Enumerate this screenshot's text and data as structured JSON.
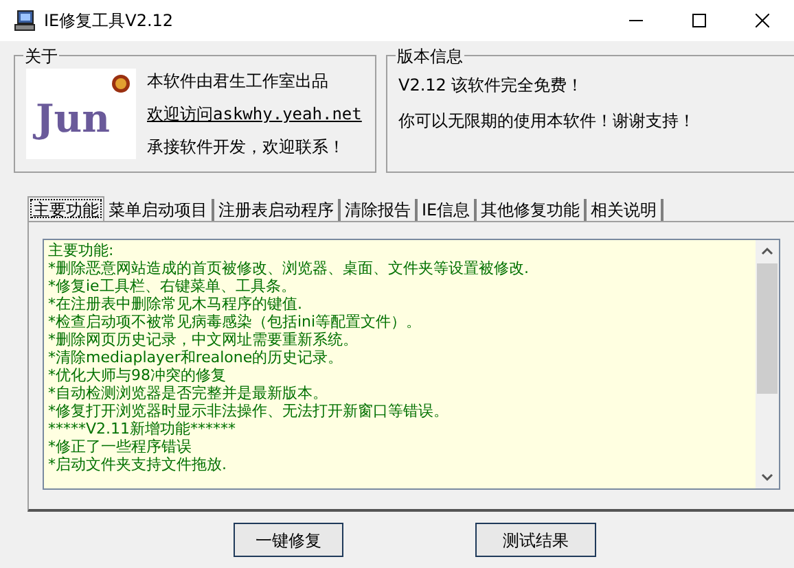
{
  "window": {
    "title": "IE修复工具V2.12"
  },
  "about": {
    "title": "关于",
    "logo_text": "Jun",
    "lines": [
      {
        "text": "本软件由君生工作室出品",
        "kind": "text"
      },
      {
        "text": "欢迎访问askwhy.yeah.net",
        "kind": "link"
      },
      {
        "text": "承接软件开发，欢迎联系！",
        "kind": "text"
      }
    ]
  },
  "version_info": {
    "title": "版本信息",
    "lines": [
      "V2.12 该软件完全免费！",
      "你可以无限期的使用本软件！谢谢支持！"
    ]
  },
  "tabs": [
    {
      "label": "主要功能",
      "selected": true
    },
    {
      "label": "菜单启动项目",
      "selected": false
    },
    {
      "label": "注册表启动程序",
      "selected": false
    },
    {
      "label": "清除报告",
      "selected": false
    },
    {
      "label": "IE信息",
      "selected": false
    },
    {
      "label": "其他修复功能",
      "selected": false
    },
    {
      "label": "相关说明",
      "selected": false
    }
  ],
  "text_area": {
    "lines": [
      "主要功能:",
      "*删除恶意网站造成的首页被修改、浏览器、桌面、文件夹等设置被修改.",
      "*修复ie工具栏、右键菜单、工具条。",
      "*在注册表中删除常见木马程序的键值.",
      "*检查启动项不被常见病毒感染（包括ini等配置文件）。",
      "*删除网页历史记录，中文网址需要重新系统。",
      "*清除mediaplayer和realone的历史记录。",
      "*优化大师与98冲突的修复",
      "*自动检测浏览器是否完整并是最新版本。",
      "*修复打开浏览器时显示非法操作、无法打开新窗口等错误。",
      "*****V2.11新增功能******",
      "*修正了一些程序错误",
      "*启动文件夹支持文件拖放."
    ]
  },
  "buttons": [
    "一键修复",
    "测试结果"
  ]
}
